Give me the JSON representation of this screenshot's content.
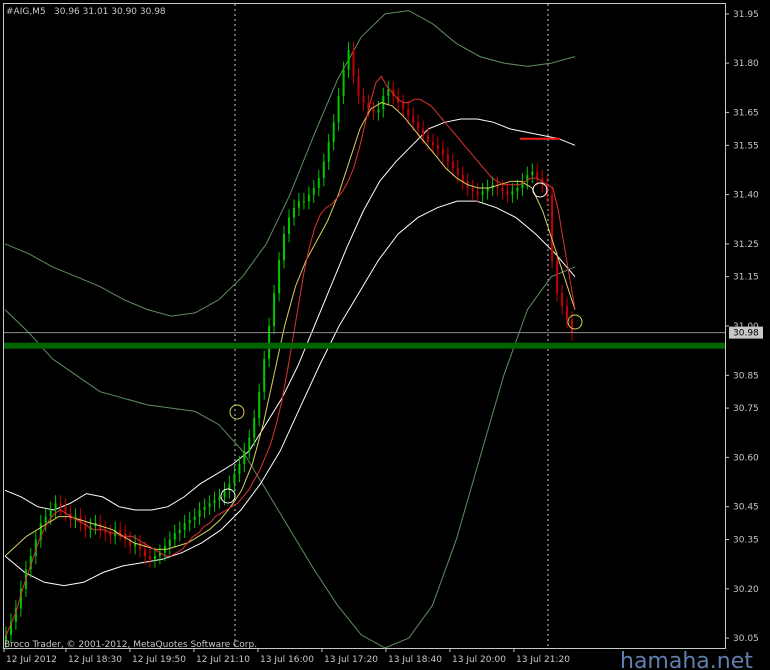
{
  "header": {
    "symbol": "#AIG,M5",
    "ohlc": "30.96 31.01 30.90 30.98"
  },
  "footer": {
    "copyright": "Broco Trader, © 2001-2012, MetaQuotes Software Corp."
  },
  "watermark": "hamaha.net",
  "colors": {
    "background": "#000000",
    "axis": "#c8c8c8",
    "bull": "#00c800",
    "bear": "#c80000",
    "ma_red": "#e03030",
    "ma_yellow": "#d8d060",
    "band_white": "#ffffff",
    "band_outer": "#5f8f5f",
    "support": "#006400",
    "price_line": "#8c8c8c",
    "resistance_mark": "#ff2020"
  },
  "chart_data": {
    "type": "candlestick",
    "symbol": "#AIG",
    "timeframe": "M5",
    "ylim": [
      30.02,
      31.98
    ],
    "y_ticks": [
      "31.95",
      "31.80",
      "31.65",
      "31.55",
      "31.40",
      "31.25",
      "31.15",
      "31.00",
      "30.85",
      "30.75",
      "30.60",
      "30.45",
      "30.35",
      "30.20",
      "30.05"
    ],
    "x_ticks": [
      "12 Jul 2012",
      "12 Jul 18:30",
      "12 Jul 19:50",
      "12 Jul 21:10",
      "13 Jul 16:00",
      "13 Jul 17:20",
      "13 Jul 18:40",
      "13 Jul 20:00",
      "13 Jul 21:20"
    ],
    "current_price": "30.98",
    "current_price_value": 30.98,
    "support_level": 30.94,
    "resistance_mark_level": 31.57,
    "closes": [
      30.06,
      30.1,
      30.14,
      30.2,
      30.26,
      30.3,
      30.35,
      30.4,
      30.42,
      30.44,
      30.46,
      30.45,
      30.43,
      30.41,
      30.42,
      30.4,
      30.38,
      30.39,
      30.4,
      30.38,
      30.37,
      30.36,
      30.38,
      30.37,
      30.35,
      30.33,
      30.34,
      30.32,
      30.3,
      30.29,
      30.3,
      30.31,
      30.33,
      30.35,
      30.37,
      30.38,
      30.4,
      30.41,
      30.42,
      30.44,
      30.45,
      30.46,
      30.47,
      30.48,
      30.5,
      30.52,
      30.55,
      30.58,
      30.62,
      30.66,
      30.72,
      30.8,
      30.9,
      31.0,
      31.1,
      31.2,
      31.28,
      31.33,
      31.36,
      31.38,
      31.38,
      31.4,
      31.42,
      31.45,
      31.5,
      31.56,
      31.62,
      31.7,
      31.78,
      31.84,
      31.76,
      31.7,
      31.68,
      31.66,
      31.65,
      31.66,
      31.7,
      31.72,
      31.7,
      31.68,
      31.66,
      31.64,
      31.62,
      31.6,
      31.58,
      31.56,
      31.55,
      31.54,
      31.52,
      31.5,
      31.48,
      31.46,
      31.44,
      31.42,
      31.41,
      31.4,
      31.41,
      31.42,
      31.43,
      31.42,
      31.41,
      31.4,
      31.41,
      31.42,
      31.44,
      31.46,
      31.47,
      31.45,
      31.43,
      31.4,
      31.2,
      31.1,
      31.06,
      31.02,
      30.98
    ],
    "ma_fast": [
      30.05,
      30.09,
      30.13,
      30.19,
      30.24,
      30.29,
      30.34,
      30.38,
      30.41,
      30.43,
      30.44,
      30.43,
      30.42,
      30.41,
      30.4,
      30.39,
      30.38,
      30.38,
      30.38,
      30.37,
      30.37,
      30.36,
      30.36,
      30.36,
      30.35,
      30.34,
      30.33,
      30.32,
      30.31,
      30.3,
      30.3,
      30.31,
      30.32,
      30.34,
      30.36,
      30.37,
      30.39,
      30.4,
      30.42,
      30.43,
      30.44,
      30.45,
      30.46,
      30.48,
      30.5,
      30.53,
      30.56,
      30.6,
      30.64,
      30.7,
      30.77,
      30.86,
      30.96,
      31.06,
      31.16,
      31.24,
      31.3,
      31.34,
      31.36,
      31.37,
      31.39,
      31.41,
      31.44,
      31.48,
      31.54,
      31.61,
      31.68,
      31.74,
      31.76,
      31.73,
      31.71,
      31.69,
      31.68,
      31.68,
      31.69,
      31.69,
      31.68,
      31.67,
      31.65,
      31.63,
      31.61,
      31.59,
      31.57,
      31.55,
      31.53,
      31.51,
      31.49,
      31.47,
      31.45,
      31.44,
      31.43,
      31.43,
      31.43,
      31.43,
      31.44,
      31.45,
      31.45,
      31.44,
      31.43,
      31.42,
      31.35,
      31.25,
      31.15,
      31.05
    ],
    "ma_slow": [
      30.3,
      30.33,
      30.36,
      30.38,
      30.4,
      30.42,
      30.42,
      30.41,
      30.4,
      30.39,
      30.38,
      30.36,
      30.34,
      30.33,
      30.32,
      30.32,
      30.33,
      30.34,
      30.36,
      30.38,
      30.41,
      30.45,
      30.5,
      30.58,
      30.7,
      30.85,
      31.0,
      31.12,
      31.2,
      31.26,
      31.32,
      31.4,
      31.5,
      31.6,
      31.66,
      31.68,
      31.67,
      31.64,
      31.6,
      31.56,
      31.52,
      31.48,
      31.45,
      31.43,
      31.42,
      31.42,
      31.43,
      31.44,
      31.44,
      31.42,
      31.35,
      31.25,
      31.15,
      31.05
    ],
    "band_upper": [
      30.5,
      30.48,
      30.45,
      30.44,
      30.46,
      30.49,
      30.48,
      30.45,
      30.44,
      30.44,
      30.45,
      30.48,
      30.52,
      30.55,
      30.58,
      30.62,
      30.7,
      30.78,
      30.88,
      31.0,
      31.12,
      31.24,
      31.35,
      31.44,
      31.5,
      31.55,
      31.6,
      31.62,
      31.63,
      31.63,
      31.62,
      31.6,
      31.59,
      31.58,
      31.57,
      31.55
    ],
    "band_lower": [
      30.3,
      30.25,
      30.22,
      30.21,
      30.22,
      30.25,
      30.27,
      30.28,
      30.29,
      30.31,
      30.34,
      30.38,
      30.44,
      30.52,
      30.62,
      30.75,
      30.88,
      31.0,
      31.1,
      31.2,
      31.28,
      31.33,
      31.36,
      31.38,
      31.38,
      31.36,
      31.33,
      31.28,
      31.22,
      31.15
    ],
    "band_outer_upper": [
      31.25,
      31.22,
      31.18,
      31.15,
      31.12,
      31.08,
      31.05,
      31.03,
      31.04,
      31.08,
      31.15,
      31.25,
      31.4,
      31.58,
      31.75,
      31.88,
      31.95,
      31.96,
      31.92,
      31.86,
      31.82,
      31.8,
      31.79,
      31.8,
      31.82
    ],
    "band_outer_lower": [
      31.05,
      30.98,
      30.9,
      30.85,
      30.8,
      30.78,
      30.76,
      30.75,
      30.74,
      30.7,
      30.62,
      30.5,
      30.38,
      30.26,
      30.15,
      30.06,
      30.02,
      30.05,
      30.15,
      30.35,
      30.6,
      30.85,
      31.05,
      31.15,
      31.18
    ]
  }
}
